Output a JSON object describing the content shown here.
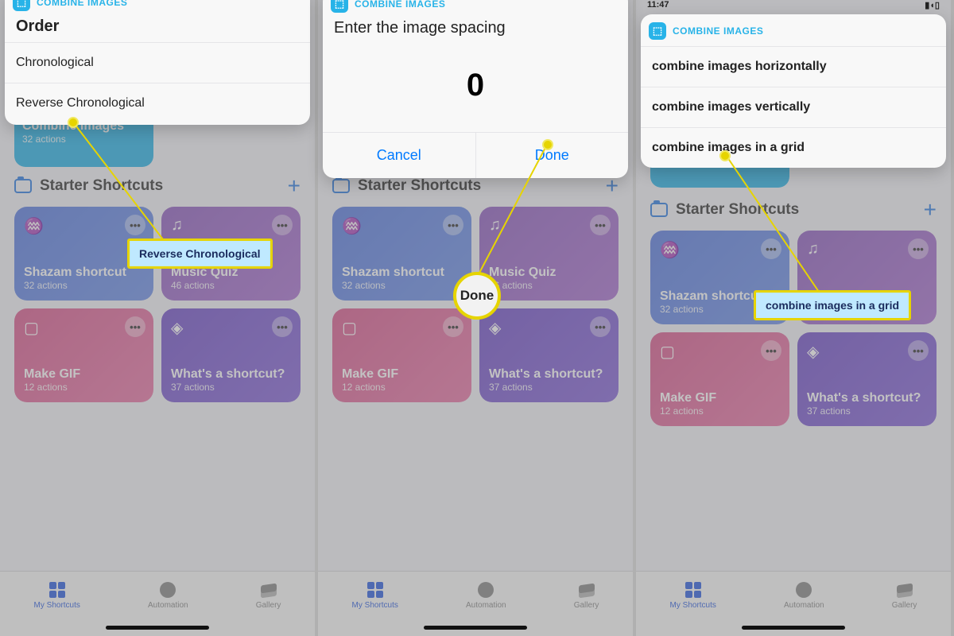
{
  "common": {
    "combine_label": "COMBINE IMAGES",
    "starter_title": "Starter Shortcuts",
    "tabs": {
      "shortcuts": "My Shortcuts",
      "automation": "Automation",
      "gallery": "Gallery"
    },
    "combine_card": {
      "title": "Combine Images",
      "actions": "32 actions"
    },
    "cards": [
      {
        "title": "Shazam shortcut",
        "sub": "32 actions"
      },
      {
        "title": "Music Quiz",
        "sub": "46 actions"
      },
      {
        "title": "Make GIF",
        "sub": "12 actions"
      },
      {
        "title": "What's a shortcut?",
        "sub": "37 actions"
      }
    ]
  },
  "phone1": {
    "popup_title": "Order",
    "options": [
      "Chronological",
      "Reverse Chronological"
    ],
    "callout": "Reverse Chronological"
  },
  "phone2": {
    "popup_title": "Enter the image spacing",
    "value": "0",
    "cancel": "Cancel",
    "done": "Done",
    "callout": "Done"
  },
  "phone3": {
    "time": "11:47",
    "options": [
      "combine images horizontally",
      "combine images vertically",
      "combine images in a grid"
    ],
    "callout": "combine images in a grid"
  }
}
